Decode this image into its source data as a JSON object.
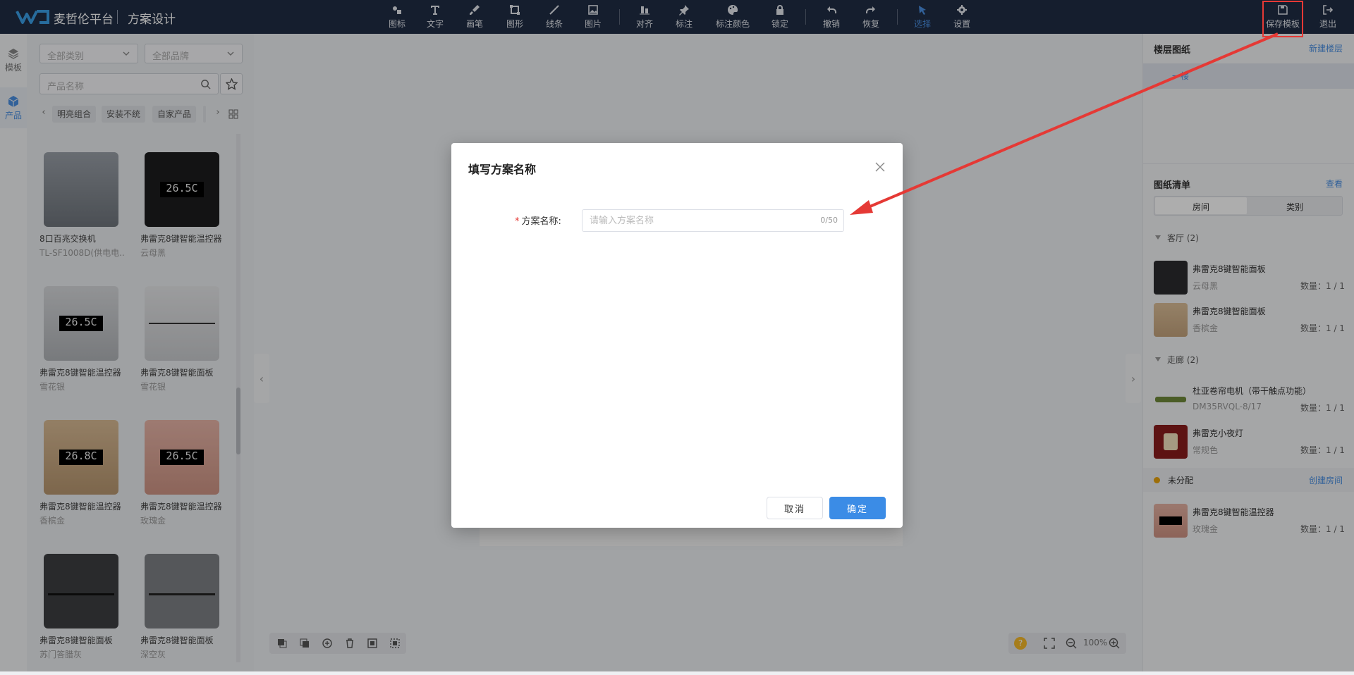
{
  "header": {
    "brand": "麦哲伦平台",
    "subtitle": "方案设计",
    "tools": [
      {
        "label": "图标",
        "icon": "icon-tool-icon"
      },
      {
        "label": "文字",
        "icon": "text-icon"
      },
      {
        "label": "画笔",
        "icon": "brush-icon"
      },
      {
        "label": "图形",
        "icon": "shape-icon"
      },
      {
        "label": "线条",
        "icon": "line-icon"
      },
      {
        "label": "图片",
        "icon": "image-icon"
      },
      {
        "label": "对齐",
        "icon": "align-icon"
      },
      {
        "label": "标注",
        "icon": "pin-icon"
      },
      {
        "label": "标注颜色",
        "icon": "palette-icon"
      },
      {
        "label": "锁定",
        "icon": "lock-icon"
      },
      {
        "label": "撤销",
        "icon": "undo-icon"
      },
      {
        "label": "恢复",
        "icon": "redo-icon"
      },
      {
        "label": "选择",
        "icon": "cursor-icon"
      },
      {
        "label": "设置",
        "icon": "gear-icon"
      }
    ],
    "save_label": "保存模板",
    "exit_label": "退出"
  },
  "leftnav": {
    "items": [
      {
        "label": "模板",
        "icon": "layers-icon"
      },
      {
        "label": "产品",
        "icon": "cube-icon"
      }
    ]
  },
  "products": {
    "category_placeholder": "全部类别",
    "brand_placeholder": "全部品牌",
    "search_placeholder": "产品名称",
    "chips": [
      "明亮组合",
      "安装不统",
      "自家产品"
    ],
    "cards": [
      {
        "name": "8口百兆交换机",
        "sub": "TL-SF1008D(供电电..."
      },
      {
        "name": "弗雷克8键智能温控器",
        "sub": "云母黑"
      },
      {
        "name": "弗雷克8键智能温控器",
        "sub": "雪花银"
      },
      {
        "name": "弗雷克8键智能面板",
        "sub": "雪花银"
      },
      {
        "name": "弗雷克8键智能温控器",
        "sub": "香槟金"
      },
      {
        "name": "弗雷克8键智能温控器",
        "sub": "玫瑰金"
      },
      {
        "name": "弗雷克8键智能面板",
        "sub": "苏门答腊灰"
      },
      {
        "name": "弗雷克8键智能面板",
        "sub": "深空灰"
      }
    ]
  },
  "right": {
    "floor_title": "楼层图纸",
    "new_floor": "新建楼层",
    "floor_item": "一楼",
    "list_title": "图纸清单",
    "view_link": "查看",
    "tab_room": "房间",
    "tab_category": "类别",
    "groups": [
      {
        "name": "客厅 (2)",
        "items": [
          {
            "name": "弗雷克8键智能面板",
            "sub": "云母黑",
            "qty": "数量：1 / 1"
          },
          {
            "name": "弗雷克8键智能面板",
            "sub": "香槟金",
            "qty": "数量：1 / 1"
          }
        ]
      },
      {
        "name": "走廊 (2)",
        "items": [
          {
            "name": "杜亚卷帘电机（带干触点功能）",
            "sub": "DM35RVQL-8/17",
            "qty": "数量：1 / 1"
          },
          {
            "name": "弗雷克小夜灯",
            "sub": "常规色",
            "qty": "数量：1 / 1"
          }
        ]
      }
    ],
    "unassigned": "未分配",
    "create_room": "创建房间",
    "unassigned_items": [
      {
        "name": "弗雷克8键智能温控器",
        "sub": "玫瑰金",
        "qty": "数量：1 / 1"
      }
    ]
  },
  "canvas": {
    "zoom": "100%"
  },
  "modal": {
    "title": "填写方案名称",
    "label": "方案名称:",
    "placeholder": "请输入方案名称",
    "value": "",
    "counter": "0/50",
    "cancel": "取消",
    "confirm": "确定"
  },
  "colors": {
    "header_bg": "#1f2d45",
    "accent": "#3b8ce6",
    "highlight_red": "#e53935"
  }
}
